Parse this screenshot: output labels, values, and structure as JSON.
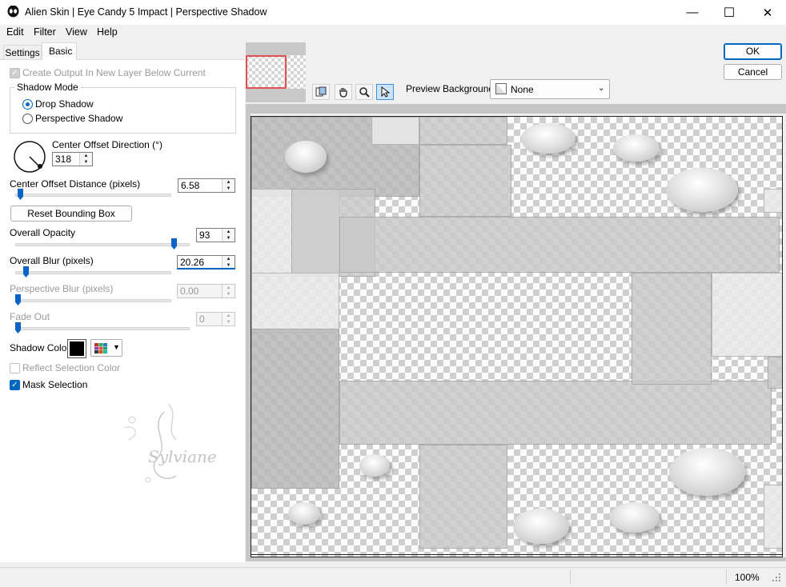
{
  "window": {
    "title": "Alien Skin | Eye Candy 5 Impact | Perspective Shadow",
    "minimize": "—",
    "maximize": "☐",
    "close": "✕"
  },
  "menu": {
    "edit": "Edit",
    "filter": "Filter",
    "view": "View",
    "help": "Help"
  },
  "tabs": {
    "settings": "Settings",
    "basic": "Basic"
  },
  "basic": {
    "create_output_label": "Create Output In New Layer Below Current",
    "shadow_mode_label": "Shadow Mode",
    "drop_shadow": "Drop Shadow",
    "perspective_shadow": "Perspective Shadow",
    "selected_mode": "Drop Shadow",
    "center_offset_direction_label": "Center Offset Direction (°)",
    "center_offset_direction_value": "318",
    "center_offset_distance_label": "Center Offset Distance (pixels)",
    "center_offset_distance_value": "6.58",
    "center_offset_distance_fraction": 0.06,
    "reset_bounding_box": "Reset Bounding Box",
    "overall_opacity_label": "Overall Opacity",
    "overall_opacity_value": "93",
    "overall_opacity_fraction": 0.93,
    "overall_blur_label": "Overall Blur (pixels)",
    "overall_blur_value": "20.26",
    "overall_blur_fraction": 0.08,
    "perspective_blur_label": "Perspective Blur (pixels)",
    "perspective_blur_value": "0.00",
    "fade_out_label": "Fade Out",
    "fade_out_value": "0",
    "shadow_color_label": "Shadow Color",
    "shadow_color": "#000000",
    "reflect_selection_color_label": "Reflect Selection Color",
    "mask_selection_label": "Mask Selection",
    "watermark_text": "Sylviane"
  },
  "actions": {
    "ok": "OK",
    "cancel": "Cancel"
  },
  "preview": {
    "background_label": "Preview Background:",
    "background_value": "None",
    "tools": [
      "preview-toggle-icon",
      "hand-icon",
      "zoom-icon",
      "pointer-icon"
    ]
  },
  "status": {
    "zoom": "100%"
  }
}
